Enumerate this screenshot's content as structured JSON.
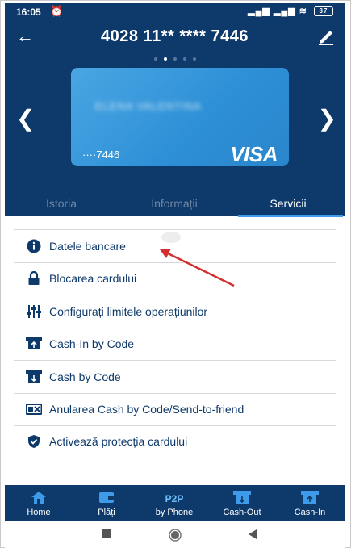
{
  "status_bar": {
    "time": "16:05",
    "battery": "37"
  },
  "header": {
    "title": "4028 11** **** 7446"
  },
  "card": {
    "holder_name": "ELENA VALENTINA",
    "number": "····7446",
    "brand": "VISA"
  },
  "tabs": [
    {
      "label": "Istoria",
      "active": false
    },
    {
      "label": "Informații",
      "active": false
    },
    {
      "label": "Servicii",
      "active": true
    }
  ],
  "services": [
    {
      "label": "Datele bancare",
      "icon": "info-icon"
    },
    {
      "label": "Blocarea cardului",
      "icon": "lock-icon"
    },
    {
      "label": "Configurați limitele operațiunilor",
      "icon": "sliders-icon"
    },
    {
      "label": "Cash-In by Code",
      "icon": "cash-in-icon"
    },
    {
      "label": "Cash by Code",
      "icon": "cash-out-icon"
    },
    {
      "label": "Anularea Cash by Code/Send-to-friend",
      "icon": "cancel-cash-icon"
    },
    {
      "label": "Activează protecția cardului",
      "icon": "shield-icon"
    }
  ],
  "bottom_nav": [
    {
      "label": "Home",
      "icon": "home-icon"
    },
    {
      "label": "Plăți",
      "icon": "wallet-icon"
    },
    {
      "label": "by Phone",
      "icon_text": "P2P"
    },
    {
      "label": "Cash-Out",
      "icon": "atm-out-icon"
    },
    {
      "label": "Cash-In",
      "icon": "atm-in-icon"
    }
  ],
  "colors": {
    "brand_dark": "#0e3a6b",
    "accent": "#3d9be9",
    "annotation": "#d32f2f"
  }
}
